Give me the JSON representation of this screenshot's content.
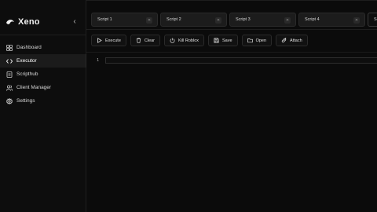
{
  "app": {
    "name": "Xeno"
  },
  "sidebar": {
    "collapse_icon": "chevron-left-icon",
    "items": [
      {
        "label": "Dashboard",
        "icon": "grid-icon",
        "active": false
      },
      {
        "label": "Executor",
        "icon": "code-icon",
        "active": true
      },
      {
        "label": "Scripthub",
        "icon": "file-icon",
        "active": false
      },
      {
        "label": "Client Manager",
        "icon": "users-icon",
        "active": false
      },
      {
        "label": "Settings",
        "icon": "gear-icon",
        "active": false
      }
    ]
  },
  "tabs": [
    {
      "label": "Script 1"
    },
    {
      "label": "Script 2"
    },
    {
      "label": "Script 3"
    },
    {
      "label": "Script 4"
    },
    {
      "label": "Sc"
    }
  ],
  "toolbar": {
    "execute": "Execute",
    "clear": "Clear",
    "kill": "Kill Roblox",
    "save": "Save",
    "open": "Open",
    "attach": "Attach"
  },
  "editor": {
    "line_number": "1",
    "content": ""
  },
  "colors": {
    "background": "#0b0b0b",
    "sidebar": "#0d0d0d",
    "tab": "#1c1c1c",
    "border": "#2a2a2a"
  }
}
